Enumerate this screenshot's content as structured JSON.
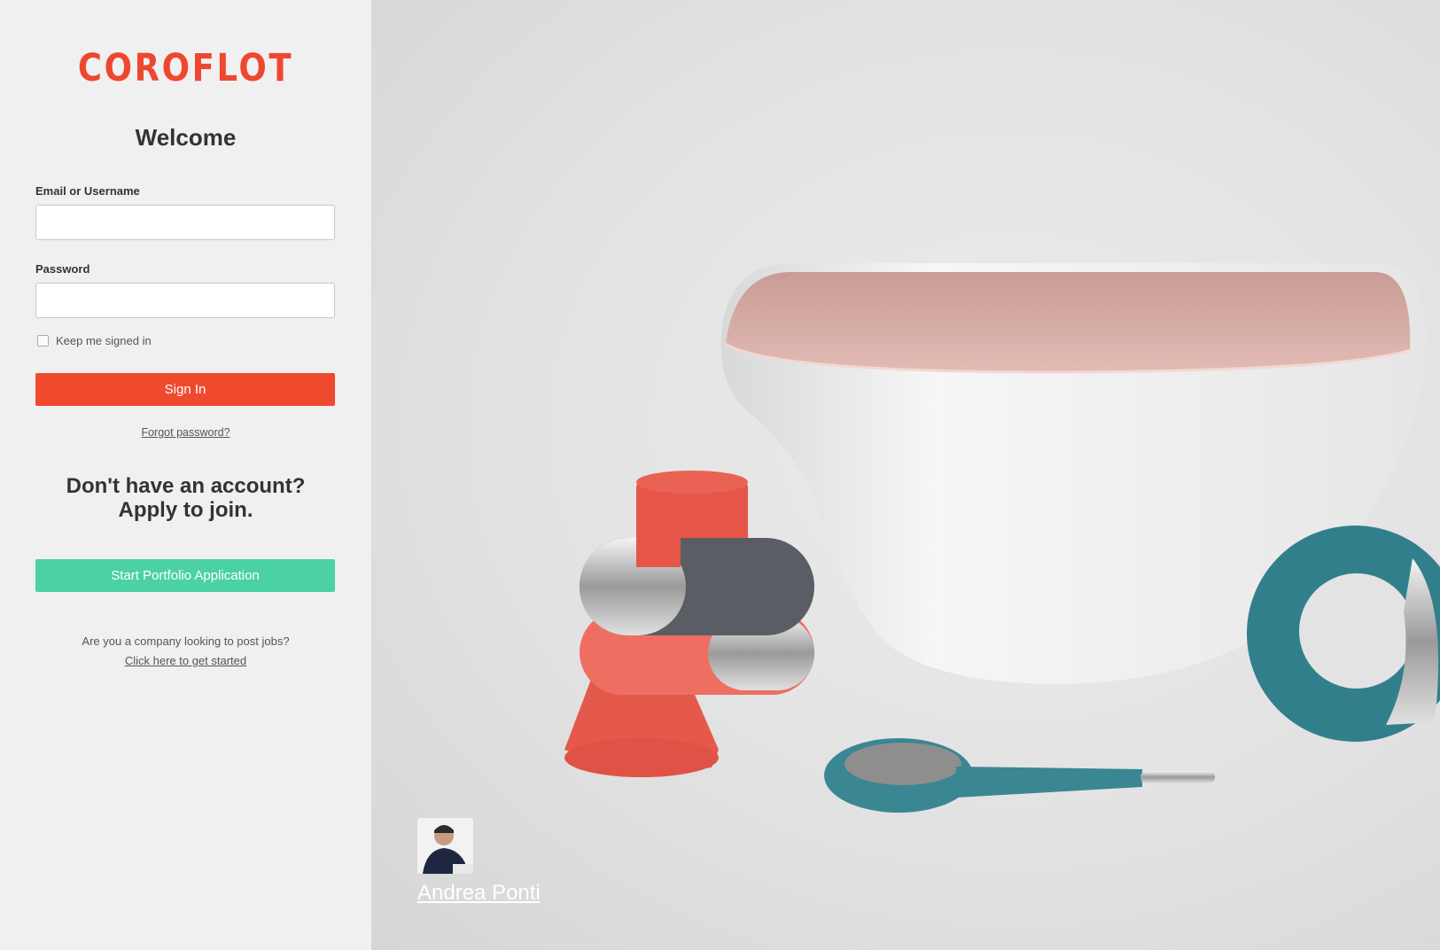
{
  "brand": {
    "logo_text": "COROFLOT",
    "accent": "#ef4a2e",
    "apply_color": "#4bd1a4"
  },
  "login": {
    "title": "Welcome",
    "email_label": "Email or Username",
    "email_value": "",
    "password_label": "Password",
    "password_value": "",
    "keep_signed_in": "Keep me signed in",
    "sign_in": "Sign In",
    "forgot": "Forgot password?"
  },
  "signup": {
    "headline_line1": "Don't have an account?",
    "headline_line2": "Apply to join.",
    "button": "Start Portfolio Application"
  },
  "company": {
    "question": "Are you a company looking to post jobs?",
    "link": "Click here to get started"
  },
  "photo_credit": {
    "name": "Andrea Ponti",
    "avatar": "person-avatar"
  }
}
